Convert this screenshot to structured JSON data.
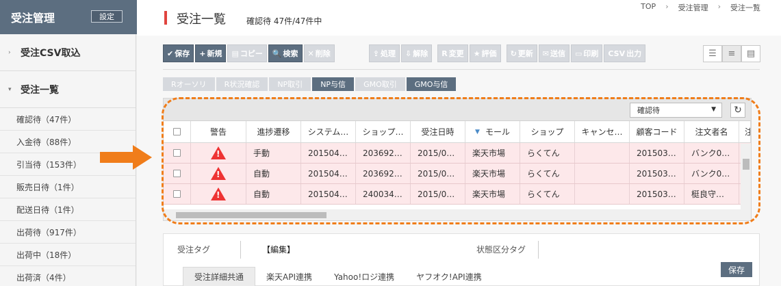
{
  "sidebar": {
    "title": "受注管理",
    "settings_label": "設定",
    "sections": [
      {
        "label": "受注CSV取込",
        "caret": "›"
      },
      {
        "label": "受注一覧",
        "caret": "▾"
      }
    ],
    "items": [
      {
        "label": "確認待（47件）"
      },
      {
        "label": "入金待（88件）"
      },
      {
        "label": "引当待（153件）"
      },
      {
        "label": "販売日待（1件）"
      },
      {
        "label": "配送日待（1件）"
      },
      {
        "label": "出荷待（917件）"
      },
      {
        "label": "出荷中（18件）"
      },
      {
        "label": "出荷済（4件）"
      }
    ]
  },
  "header": {
    "title": "受注一覧",
    "subtitle": "確認待 47件/47件中",
    "breadcrumb": [
      "TOP",
      "受注管理",
      "受注一覧"
    ],
    "breadcrumb_sep": "›"
  },
  "toolbar": {
    "buttons": [
      {
        "icon": "✔",
        "label": "保存"
      },
      {
        "icon": "+",
        "label": "新規"
      },
      {
        "icon": "▤",
        "label": "コピー"
      },
      {
        "icon": "🔍",
        "label": "検索"
      },
      {
        "icon": "✕",
        "label": "削除"
      },
      {
        "icon": "⇪",
        "label": "処理"
      },
      {
        "icon": "⇩",
        "label": "解除"
      },
      {
        "icon": "R",
        "label": "変更"
      },
      {
        "icon": "★",
        "label": "評価"
      },
      {
        "icon": "↻",
        "label": "更新"
      },
      {
        "icon": "✉",
        "label": "送信"
      },
      {
        "icon": "▭",
        "label": "印刷"
      },
      {
        "icon": "CSV",
        "label": "出力"
      }
    ]
  },
  "tags": [
    "Rオーソリ",
    "R状況確認",
    "NP取引",
    "NP与信",
    "GMO取引",
    "GMO与信"
  ],
  "grid": {
    "status_select": "確認待",
    "columns": [
      "",
      "警告",
      "進捗遷移",
      "システム…",
      "ショップ…",
      "受注日時",
      "モール",
      "ショップ",
      "キャンセ…",
      "顧客コード",
      "注文者名",
      "注文"
    ],
    "sort_indicator": "▼",
    "rows": [
      {
        "progress": "手動",
        "system": "201504…",
        "shop_no": "203692…",
        "date": "2015/0…",
        "mall": "楽天市場",
        "shop": "らくてん",
        "cancel": "",
        "customer": "201503…",
        "orderer": "バンク0…",
        "warn_mark": "!"
      },
      {
        "progress": "自動",
        "system": "201504…",
        "shop_no": "203692…",
        "date": "2015/0…",
        "mall": "楽天市場",
        "shop": "らくてん",
        "cancel": "",
        "customer": "201503…",
        "orderer": "バンク0…",
        "warn_mark": "!"
      },
      {
        "progress": "自動",
        "system": "201504…",
        "shop_no": "240034…",
        "date": "2015/0…",
        "mall": "楽天市場",
        "shop": "らくてん",
        "cancel": "",
        "customer": "201503…",
        "orderer": "梃良守…",
        "warn_mark": "!"
      }
    ]
  },
  "lower": {
    "order_tag_label": "受注タグ",
    "edit_label": "【編集】",
    "status_tag_label": "状態区分タグ",
    "save_label": "保存",
    "tabs": [
      "受注詳細共通",
      "楽天API連携",
      "Yahoo!ロジ連携",
      "ヤフオク!API連携"
    ]
  },
  "colors": {
    "accent": "#5c6e80",
    "highlight": "#f07d1a",
    "warn": "#e33",
    "row_bg": "#fde8ea"
  }
}
